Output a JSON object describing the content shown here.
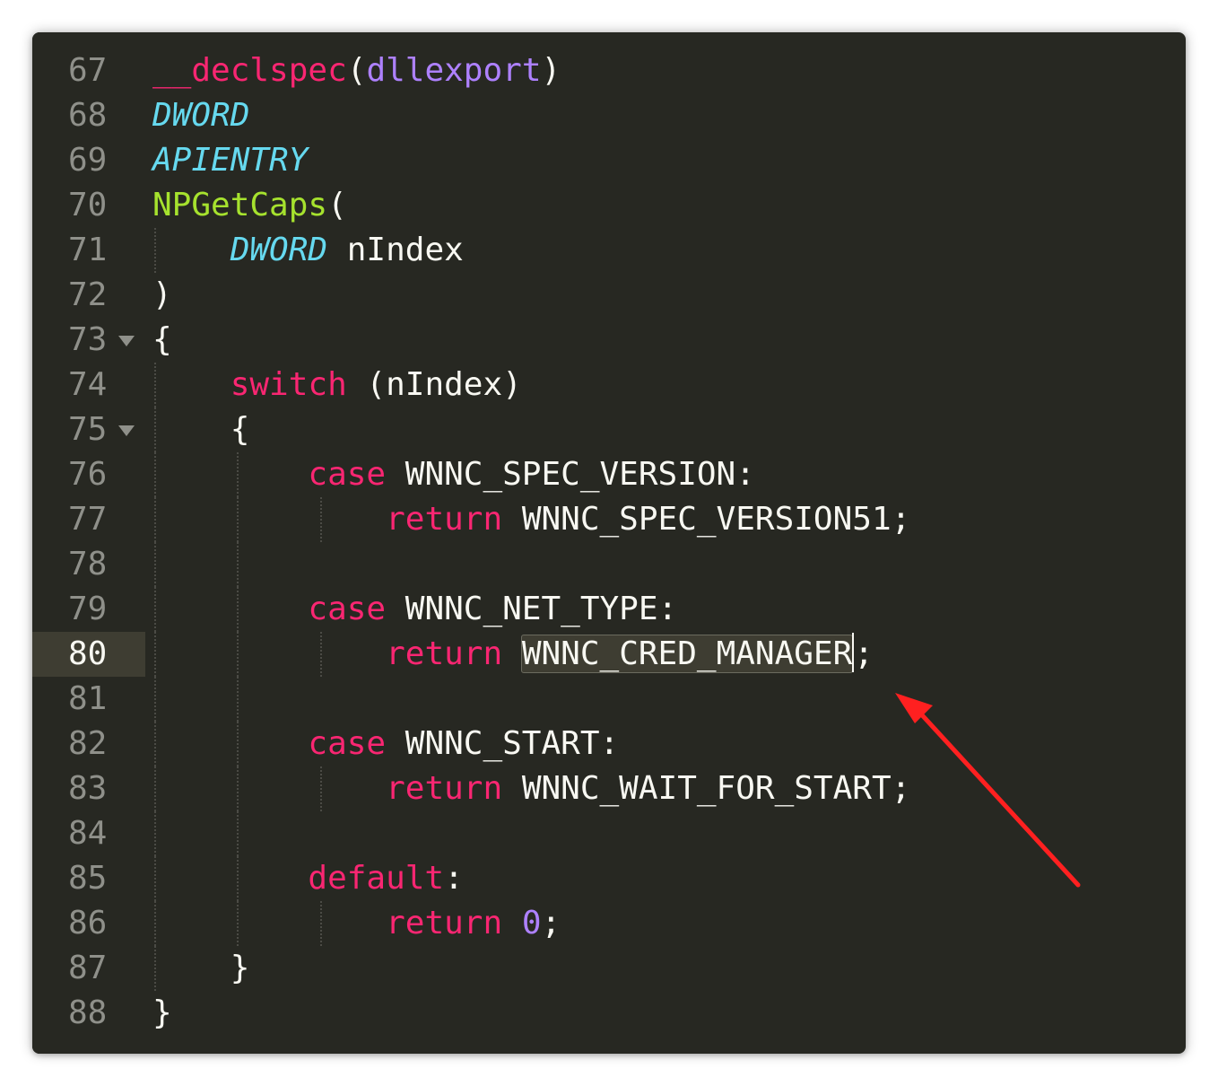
{
  "editor": {
    "theme_colors": {
      "background": "#272822",
      "keyword": "#f92672",
      "type": "#66d9ef",
      "function": "#a6e22e",
      "constant": "#ae81ff",
      "text": "#f8f8f2",
      "line_number": "#8f908a",
      "annotation_arrow": "#ff2020"
    },
    "current_line": "80",
    "lines": [
      {
        "num": "67",
        "tokens": [
          {
            "t": "__declspec",
            "c": "kw"
          },
          {
            "t": "(",
            "c": "plain"
          },
          {
            "t": "dllexport",
            "c": "con"
          },
          {
            "t": ")",
            "c": "plain"
          }
        ]
      },
      {
        "num": "68",
        "tokens": [
          {
            "t": "DWORD",
            "c": "ty"
          }
        ]
      },
      {
        "num": "69",
        "tokens": [
          {
            "t": "APIENTRY",
            "c": "ty"
          }
        ]
      },
      {
        "num": "70",
        "tokens": [
          {
            "t": "NPGetCaps",
            "c": "fn"
          },
          {
            "t": "(",
            "c": "plain"
          }
        ]
      },
      {
        "num": "71",
        "tokens": [
          {
            "t": "    ",
            "c": "plain"
          },
          {
            "t": "DWORD",
            "c": "ty"
          },
          {
            "t": " nIndex",
            "c": "plain"
          }
        ]
      },
      {
        "num": "72",
        "tokens": [
          {
            "t": ")",
            "c": "plain"
          }
        ]
      },
      {
        "num": "73",
        "fold": true,
        "tokens": [
          {
            "t": "{",
            "c": "plain"
          }
        ]
      },
      {
        "num": "74",
        "tokens": [
          {
            "t": "    ",
            "c": "plain"
          },
          {
            "t": "switch",
            "c": "kw"
          },
          {
            "t": " (nIndex)",
            "c": "plain"
          }
        ]
      },
      {
        "num": "75",
        "fold": true,
        "tokens": [
          {
            "t": "    {",
            "c": "plain"
          }
        ]
      },
      {
        "num": "76",
        "tokens": [
          {
            "t": "        ",
            "c": "plain"
          },
          {
            "t": "case",
            "c": "kw"
          },
          {
            "t": " WNNC_SPEC_VERSION:",
            "c": "plain"
          }
        ]
      },
      {
        "num": "77",
        "tokens": [
          {
            "t": "            ",
            "c": "plain"
          },
          {
            "t": "return",
            "c": "kw"
          },
          {
            "t": " WNNC_SPEC_VERSION51;",
            "c": "plain"
          }
        ]
      },
      {
        "num": "78",
        "tokens": []
      },
      {
        "num": "79",
        "tokens": [
          {
            "t": "        ",
            "c": "plain"
          },
          {
            "t": "case",
            "c": "kw"
          },
          {
            "t": " WNNC_NET_TYPE:",
            "c": "plain"
          }
        ]
      },
      {
        "num": "80",
        "tokens": [
          {
            "t": "            ",
            "c": "plain"
          },
          {
            "t": "return",
            "c": "kw"
          },
          {
            "t": " ",
            "c": "plain"
          },
          {
            "t": "WNNC_CRED_MANAGER",
            "c": "plain sel"
          },
          {
            "t": "",
            "c": "caret"
          },
          {
            "t": ";",
            "c": "plain"
          }
        ]
      },
      {
        "num": "81",
        "tokens": []
      },
      {
        "num": "82",
        "tokens": [
          {
            "t": "        ",
            "c": "plain"
          },
          {
            "t": "case",
            "c": "kw"
          },
          {
            "t": " WNNC_START:",
            "c": "plain"
          }
        ]
      },
      {
        "num": "83",
        "tokens": [
          {
            "t": "            ",
            "c": "plain"
          },
          {
            "t": "return",
            "c": "kw"
          },
          {
            "t": " WNNC_WAIT_FOR_START;",
            "c": "plain"
          }
        ]
      },
      {
        "num": "84",
        "tokens": []
      },
      {
        "num": "85",
        "tokens": [
          {
            "t": "        ",
            "c": "plain"
          },
          {
            "t": "default",
            "c": "kw"
          },
          {
            "t": ":",
            "c": "plain"
          }
        ]
      },
      {
        "num": "86",
        "tokens": [
          {
            "t": "            ",
            "c": "plain"
          },
          {
            "t": "return",
            "c": "kw"
          },
          {
            "t": " ",
            "c": "plain"
          },
          {
            "t": "0",
            "c": "con"
          },
          {
            "t": ";",
            "c": "plain"
          }
        ]
      },
      {
        "num": "87",
        "tokens": [
          {
            "t": "    }",
            "c": "plain"
          }
        ]
      },
      {
        "num": "88",
        "tokens": [
          {
            "t": "}",
            "c": "plain"
          }
        ]
      }
    ]
  }
}
